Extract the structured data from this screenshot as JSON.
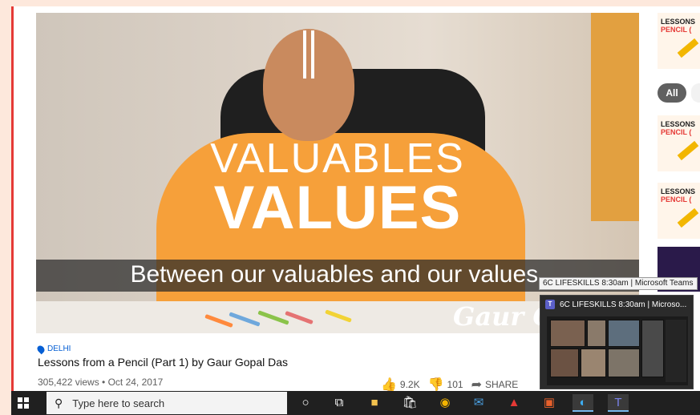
{
  "video": {
    "overlay_title_light": "VALUABLES",
    "overlay_title_bold": "VALUES",
    "caption": "Between our valuables and our values.",
    "watermark": "Gaur G"
  },
  "meta": {
    "location": "DELHI",
    "title": "Lessons from a Pencil (Part 1) by Gaur Gopal Das",
    "views": "305,422 views • Oct 24, 2017",
    "likes": "9.2K",
    "dislikes": "101",
    "share": "SHARE"
  },
  "sidebar": {
    "chip_all": "All",
    "thumb_line1": "LESSONS",
    "thumb_line2": "PENCIL ("
  },
  "teams": {
    "tooltip": "6C LIFESKILLS 8:30am | Microsoft Teams",
    "preview_title": "6C LIFESKILLS 8:30am | Microso..."
  },
  "taskbar": {
    "search_placeholder": "Type here to search",
    "icons": [
      "cortana-icon",
      "task-view-icon",
      "file-explorer-icon",
      "store-icon",
      "chrome-icon",
      "mail-icon",
      "acrobat-icon",
      "office-icon",
      "edge-icon",
      "teams-icon"
    ]
  },
  "colors": {
    "accent_red": "#e53935",
    "link_blue": "#065fd4",
    "robe": "#f6a03a",
    "taskbar": "#202020",
    "teams": "#5b5fc7"
  }
}
